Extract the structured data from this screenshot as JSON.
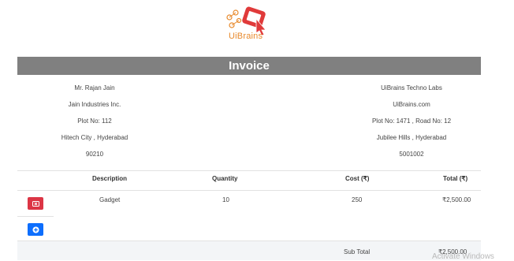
{
  "brand": {
    "logo_text": "UiBrains"
  },
  "invoice_title": "Invoice",
  "bill_to": [
    "Mr. Rajan Jain",
    "Jain Industries Inc.",
    "Plot No: 112",
    "Hitech City , Hyderabad",
    "90210"
  ],
  "bill_from": [
    "UiBrains Techno Labs",
    "UiBrains.com",
    "Plot No: 1471 , Road No: 12",
    "Jubilee Hills , Hyderabad",
    "5001002"
  ],
  "table": {
    "headers": {
      "description": "Description",
      "quantity": "Quantity",
      "cost": "Cost (₹)",
      "total": "Total (₹)"
    },
    "rows": [
      {
        "description": "Gadget",
        "quantity": "10",
        "cost": "250",
        "total": "₹2,500.00"
      }
    ]
  },
  "subtotal": {
    "label": "Sub Total",
    "value": "₹2,500.00"
  },
  "watermark": "Activate Windows",
  "colors": {
    "banner": "#808080",
    "delete": "#dc3545",
    "add": "#0d6efd",
    "brand_orange": "#e8892b",
    "brand_red": "#e03a3a"
  },
  "icons": {
    "delete": "x-icon",
    "add": "plus-icon"
  }
}
